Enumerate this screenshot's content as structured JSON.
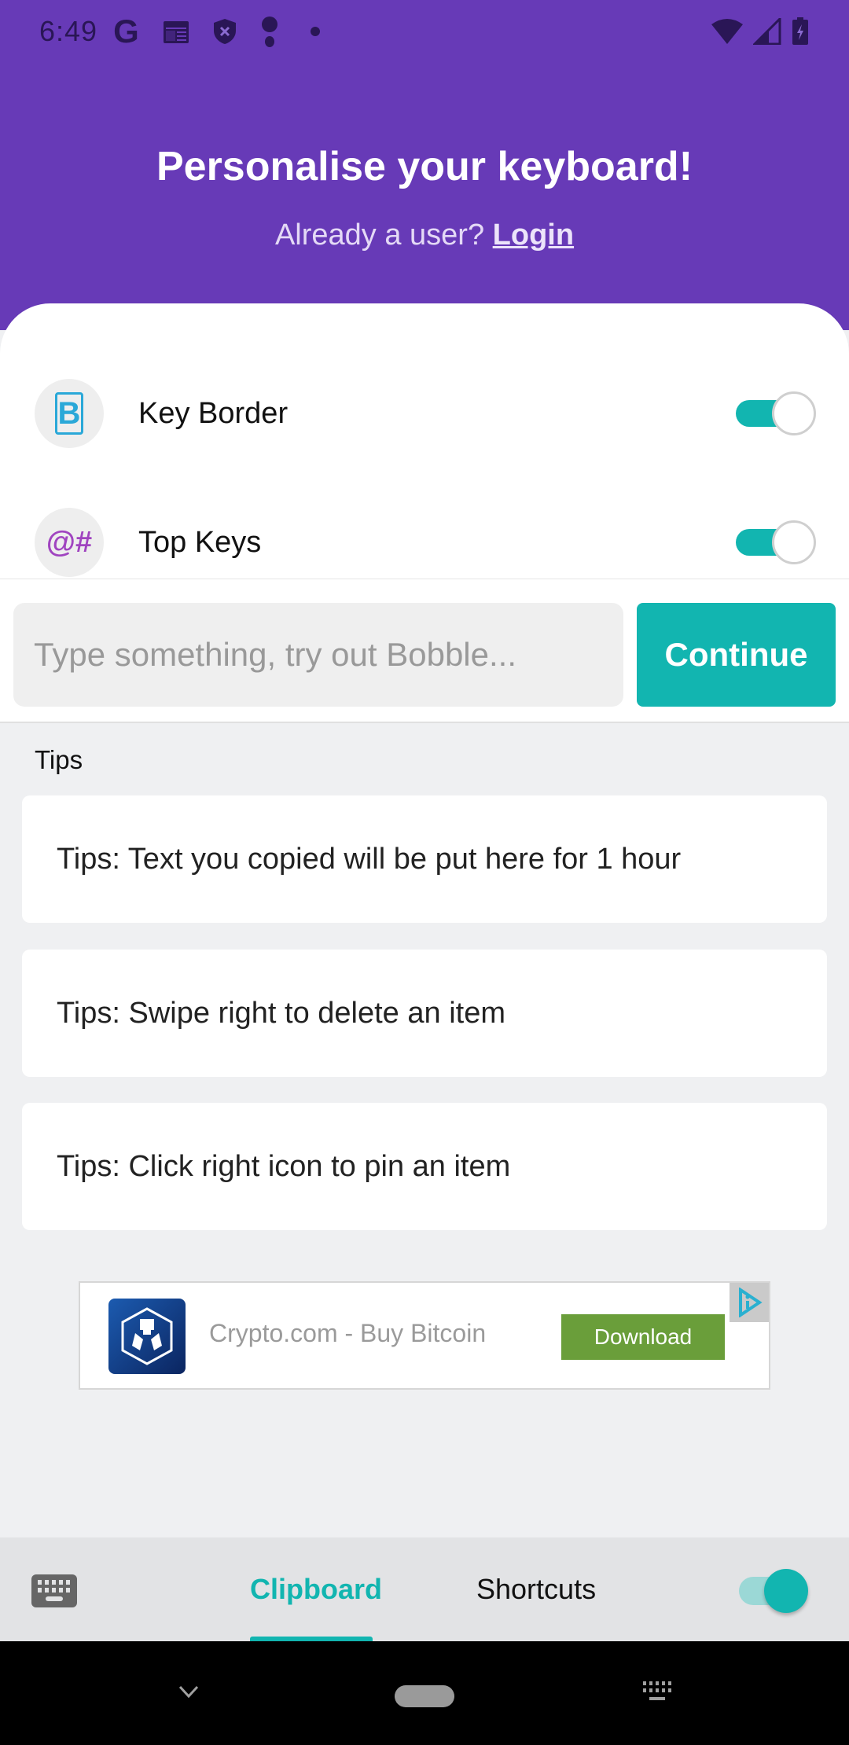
{
  "status_bar": {
    "time": "6:49",
    "left_icons": [
      "google-icon",
      "news-icon",
      "shield-x-icon",
      "character-icon",
      "dot-icon"
    ],
    "right_icons": [
      "wifi-icon",
      "cell-signal-icon",
      "battery-charging-icon"
    ]
  },
  "header": {
    "title": "Personalise your keyboard!",
    "subtitle_prefix": "Already a user?",
    "login_label": "Login"
  },
  "settings": [
    {
      "label": "Key Border",
      "icon": "key-border-icon",
      "icon_glyph": "B",
      "enabled": true
    },
    {
      "label": "Top Keys",
      "icon": "top-keys-icon",
      "icon_glyph": "@#",
      "enabled": true
    }
  ],
  "input_bar": {
    "value": "",
    "placeholder": "Type something, try out Bobble...",
    "continue_label": "Continue"
  },
  "tips": {
    "heading": "Tips",
    "items": [
      "Tips: Text you copied will be put here for 1 hour",
      "Tips: Swipe right to delete an item",
      "Tips: Click right icon to pin an item"
    ]
  },
  "ad": {
    "title": "Crypto.com - Buy Bitcoin",
    "button_label": "Download",
    "logo": "crypto-com-logo",
    "choice_icon": "ad-choices-icon"
  },
  "tab_bar": {
    "tabs": [
      {
        "label": "Clipboard",
        "active": true
      },
      {
        "label": "Shortcuts",
        "active": false
      }
    ],
    "toggle_enabled": true
  },
  "colors": {
    "header_purple": "#673ab7",
    "accent_teal": "#12b5b0",
    "ad_button_green": "#6a9e3a"
  },
  "nav_bar": {
    "buttons": [
      "back-chevron-icon",
      "home-pill",
      "keyboard-switch-icon"
    ]
  }
}
